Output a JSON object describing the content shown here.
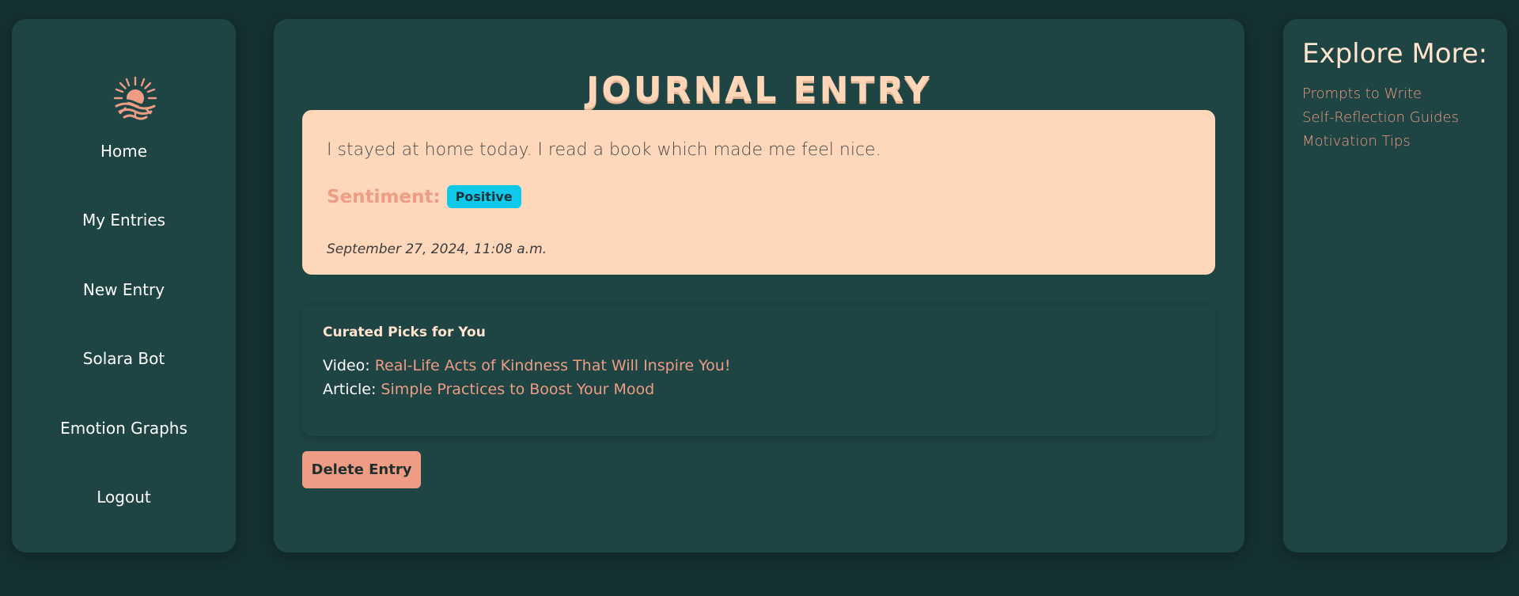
{
  "colors": {
    "background": "#14302f",
    "panel": "#1f4444",
    "accent": "#ee9c83",
    "card": "#ffd8bc",
    "badge": "#0fc9ea",
    "heading": "#ffe3cc"
  },
  "sidebar": {
    "logo_icon": "sun-over-waves-icon",
    "items": [
      {
        "label": "Home"
      },
      {
        "label": "My Entries"
      },
      {
        "label": "New Entry"
      },
      {
        "label": "Solara Bot"
      },
      {
        "label": "Emotion Graphs"
      },
      {
        "label": "Logout"
      }
    ]
  },
  "main": {
    "title": "JOURNAL ENTRY",
    "entry": {
      "text": "I stayed at home today. I read a book which made me feel nice.",
      "sentiment_label": "Sentiment:",
      "sentiment_value": "Positive",
      "date": "September 27, 2024, 11:08 a.m."
    },
    "picks": {
      "title": "Curated Picks for You",
      "items": [
        {
          "type_label": "Video:",
          "link": "Real-Life Acts of Kindness That Will Inspire You!"
        },
        {
          "type_label": "Article:",
          "link": "Simple Practices to Boost Your Mood"
        }
      ]
    },
    "delete_label": "Delete Entry"
  },
  "explore": {
    "title": "Explore More:",
    "links": [
      {
        "label": "Prompts to Write"
      },
      {
        "label": "Self-Reflection Guides"
      },
      {
        "label": "Motivation Tips"
      }
    ]
  }
}
